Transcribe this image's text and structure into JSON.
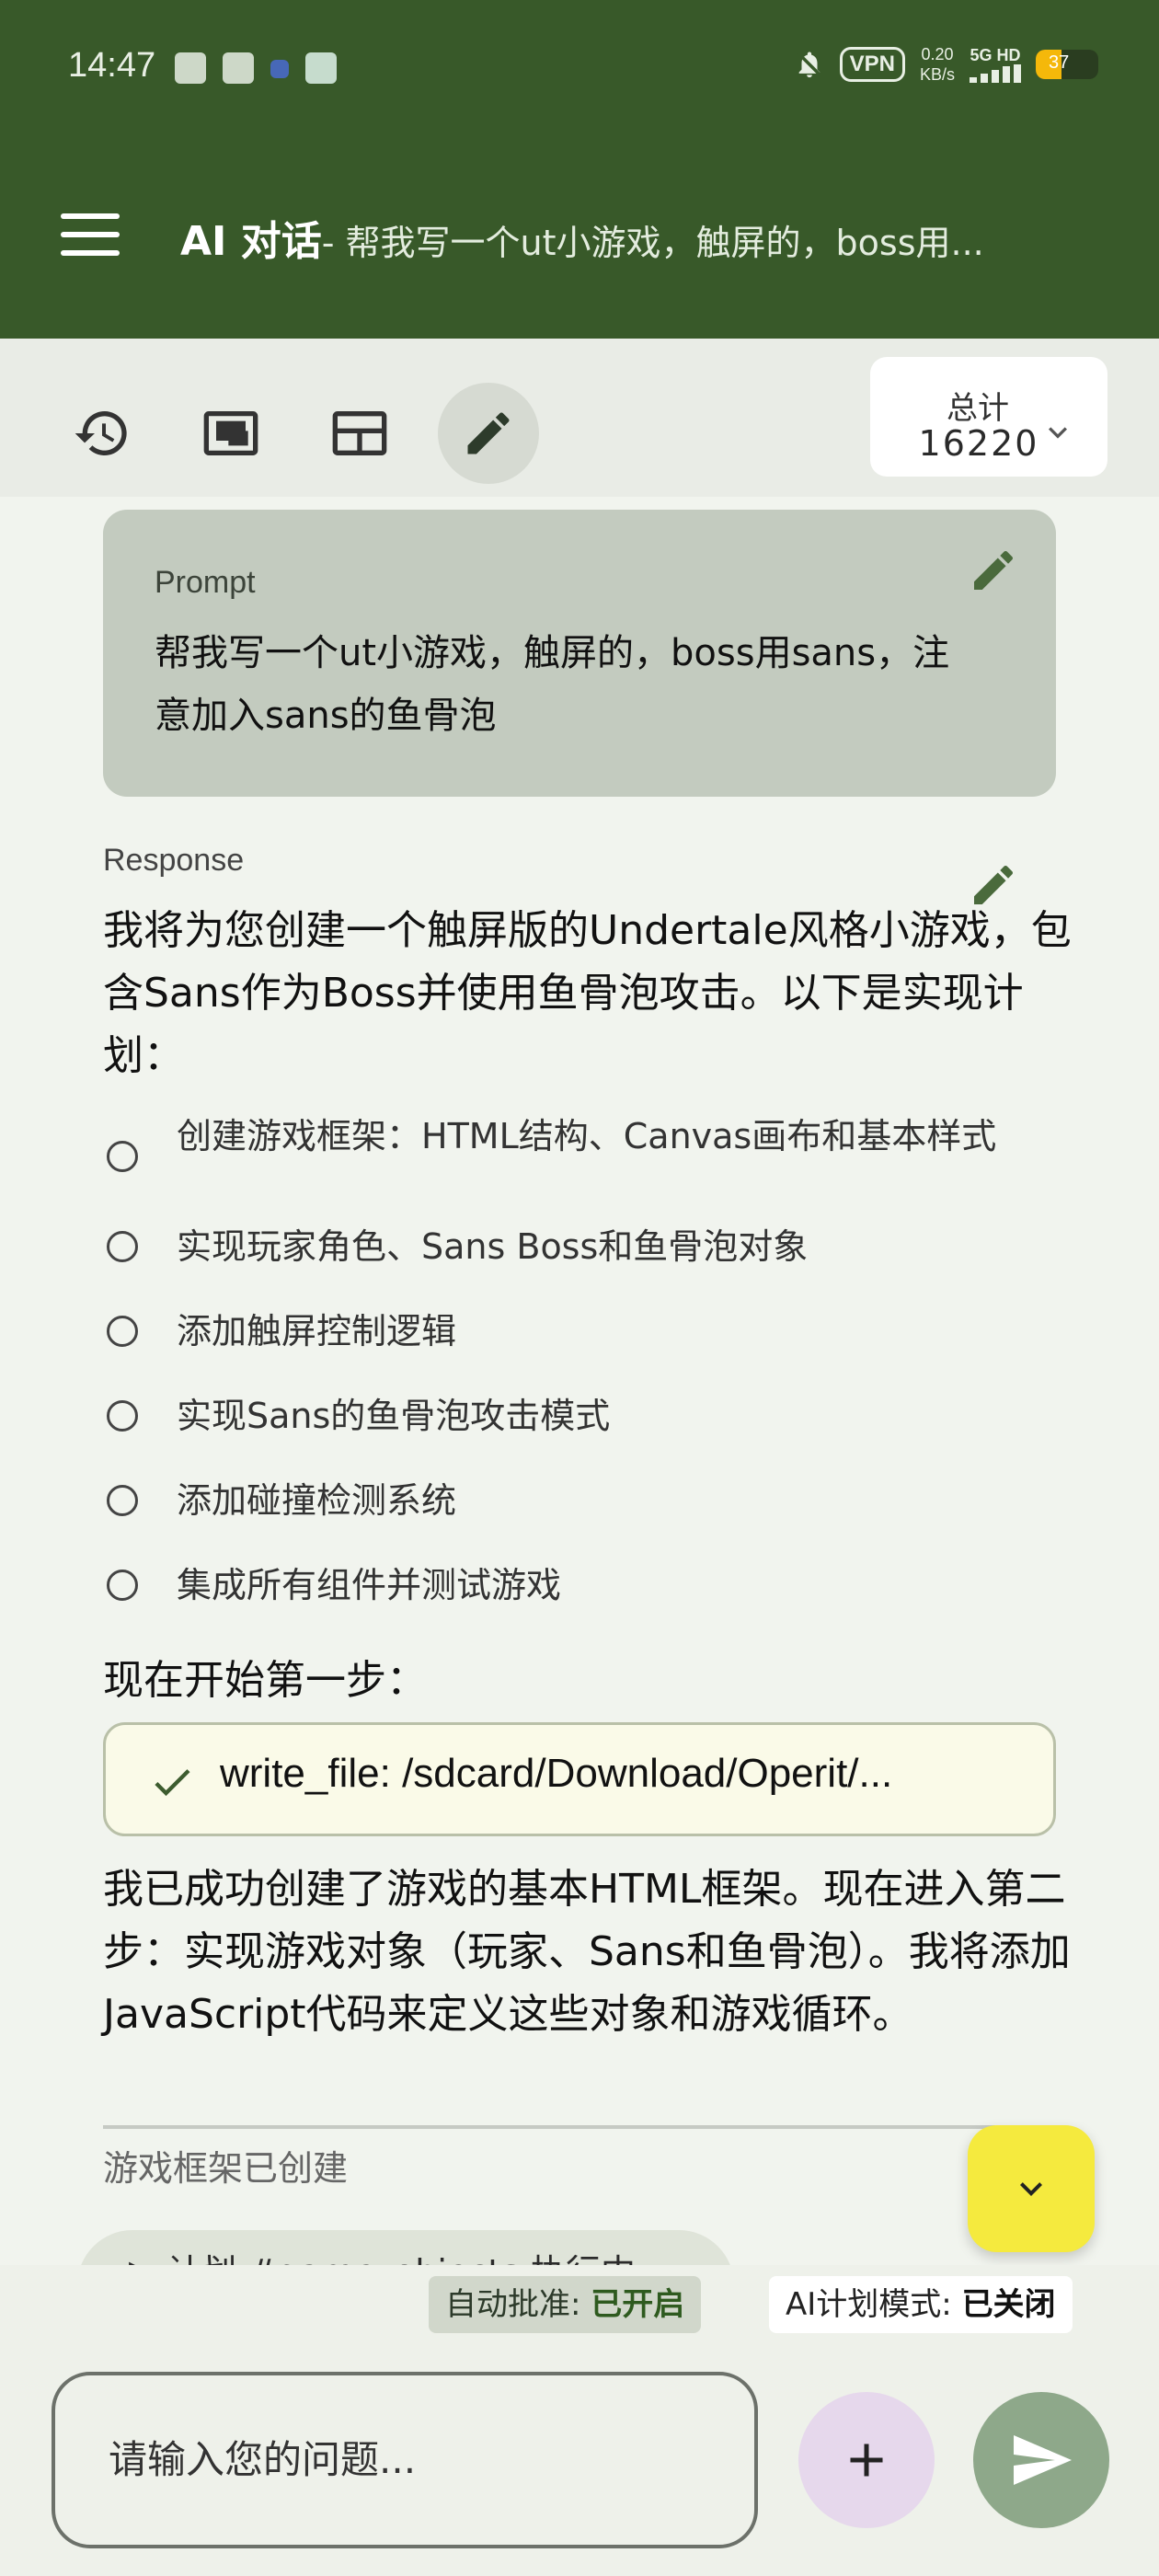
{
  "status_bar": {
    "time": "14:47",
    "vpn": "VPN",
    "speed_value": "0.20",
    "speed_unit": "KB/s",
    "network": "5G HD",
    "battery": "37"
  },
  "app_bar": {
    "title": "AI 对话",
    "subtitle": "- 帮我写一个ut小游戏，触屏的，boss用..."
  },
  "toolbar": {
    "totals_label": "总计",
    "totals_value": "16220"
  },
  "prompt": {
    "label": "Prompt",
    "text": "帮我写一个ut小游戏，触屏的，boss用sans，注意加入sans的鱼骨泡"
  },
  "response": {
    "label": "Response",
    "intro": "我将为您创建一个触屏版的Undertale风格小游戏，包含Sans作为Boss并使用鱼骨泡攻击。以下是实现计划：",
    "todos": [
      "创建游戏框架：HTML结构、Canvas画布和基本样式",
      "实现玩家角色、Sans Boss和鱼骨泡对象",
      "添加触屏控制逻辑",
      "实现Sans的鱼骨泡攻击模式",
      "添加碰撞检测系统",
      "集成所有组件并测试游戏"
    ],
    "step_text": "现在开始第一步：",
    "tool_call": "write_file: /sdcard/Download/Operit/...",
    "followup": "我已成功创建了游戏的基本HTML框架。现在进入第二步：实现游戏对象（玩家、Sans和鱼骨泡）。我将添加JavaScript代码来定义这些对象和游戏循环。",
    "plan_done": "游戏框架已创建",
    "plan_chip": "▶ 计划 #game_objects 执行中"
  },
  "bottom": {
    "auto_approve_label": "自动批准:",
    "auto_approve_value": "已开启",
    "plan_mode_label": "AI计划模式:",
    "plan_mode_value": "已关闭",
    "input_placeholder": "请输入您的问题..."
  },
  "colors": {
    "app_bar": "#385929",
    "prompt_card": "#c3cbbf",
    "tool_card_bg": "#fafae8",
    "fab_yellow": "#f5ea3e",
    "send_button": "#8ea88a",
    "plus_button": "#e6d8ec"
  },
  "icons": {
    "toolbar": [
      "history-icon",
      "picture-in-picture-icon",
      "layout-icon",
      "edit-pencil-icon"
    ],
    "totals": "chevron-down-icon",
    "tool_status": "check-icon",
    "scroll": "chevron-down-icon",
    "add": "plus-icon",
    "send": "send-icon"
  }
}
